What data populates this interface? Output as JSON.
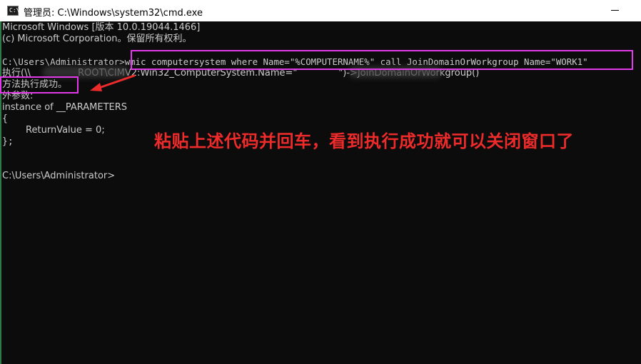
{
  "window": {
    "title": "管理员: C:\\Windows\\system32\\cmd.exe",
    "icon": "cmd-icon",
    "icon_glyph": "C:\\"
  },
  "terminal": {
    "lines": [
      "Microsoft Windows [版本 10.0.19044.1466]",
      "(c) Microsoft Corporation。保留所有权利。",
      "",
      "C:\\Users\\Administrator>wmic computersystem where Name=\"%COMPUTERNAME%\" call JoinDomainOrWorkgroup Name=\"WORK1\"",
      "执行(\\\\                ROOT\\CIMV2:Win32_ComputerSystem.Name=\"              \")->JoinDomainOrWorkgroup()",
      "方法执行成功。",
      "外参数:",
      "instance of __PARAMETERS",
      "{",
      "        ReturnValue = 0;",
      "};",
      "",
      "",
      "C:\\Users\\Administrator>"
    ]
  },
  "annotation": {
    "text": "粘贴上述代码并回车，看到执行成功就可以关闭窗口了",
    "color": "#ee2b2b",
    "highlight_color": "#e23ae8"
  }
}
